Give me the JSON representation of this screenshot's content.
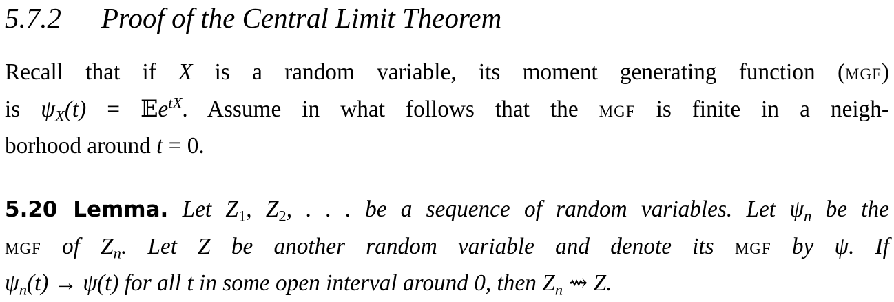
{
  "section": {
    "number": "5.7.2",
    "title": "Proof of the Central Limit Theorem"
  },
  "intro": {
    "line1": {
      "a": "Recall that if ",
      "X": "X",
      "b": " is a random variable, its moment generating function (",
      "mgf": "mgf",
      "c": ")"
    },
    "line2": {
      "a": "is ",
      "psi": "ψ",
      "psi_sub": "X",
      "arg": "(t)",
      "eq": " = ",
      "E": "𝔼",
      "e": "e",
      "exp": "tX",
      "b": ". Assume in what follows that the ",
      "mgf": "mgf",
      "c": " is finite in a neigh-"
    },
    "line3": {
      "a": "borhood around ",
      "t": "t",
      "eq": " = 0."
    }
  },
  "lemma": {
    "label": "5.20 Lemma.",
    "line1": {
      "a": "  Let ",
      "z": "Z",
      "z_sub1": "1",
      "comma": ", ",
      "z2": "Z",
      "z_sub2": "2",
      "dots": ", . . .",
      "b": " be a sequence of random variables. Let ",
      "psi": "ψ",
      "psi_sub": "n",
      "c": " be the"
    },
    "line2": {
      "mgf": "mgf",
      "a": " of ",
      "z": "Z",
      "z_sub": "n",
      "b": ". Let ",
      "z2": "Z",
      "c": " be another random variable and denote its ",
      "mgf2": "mgf",
      "d": " by ",
      "psi": "ψ",
      "e": ". If"
    },
    "line3": {
      "psi": "ψ",
      "psi_sub": "n",
      "a": "(t) → ψ(t)",
      "b": " for all ",
      "t": "t",
      "c": " in some open interval around 0, then ",
      "z": "Z",
      "z_sub": "n",
      "arrow": " ⇝ ",
      "z2": "Z",
      "d": "."
    }
  }
}
